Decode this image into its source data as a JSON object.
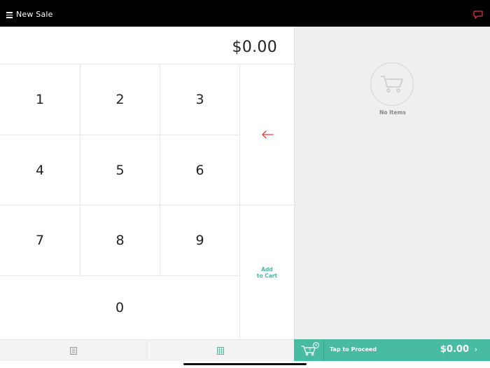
{
  "header": {
    "title": "New Sale",
    "menu_icon": "hamburger-menu-icon",
    "chat_icon": "chat-bubble-icon"
  },
  "amount_display": {
    "value": "$0.00"
  },
  "keypad": {
    "keys": [
      "1",
      "2",
      "3",
      "4",
      "5",
      "6",
      "7",
      "8",
      "9",
      "0"
    ],
    "backspace_icon": "arrow-left-icon",
    "add_to_cart_label": "Add\nto Cart"
  },
  "bottom_tabs": [
    {
      "name": "list-tab",
      "icon": "list-icon"
    },
    {
      "name": "keypad-tab",
      "icon": "grid-icon",
      "active": true
    }
  ],
  "cart_panel": {
    "empty_label": "No Items",
    "empty_icon": "cart-icon"
  },
  "checkout_bar": {
    "cart_count": "0",
    "clear_icon": "close-circle-icon",
    "proceed_label": "Tap to Proceed",
    "total": "$0.00",
    "chevron_icon": "chevron-right-icon"
  },
  "colors": {
    "accent": "#49bba2",
    "accent_text": "#3ebba0",
    "backspace": "#e53935",
    "header_bg": "#000000"
  }
}
